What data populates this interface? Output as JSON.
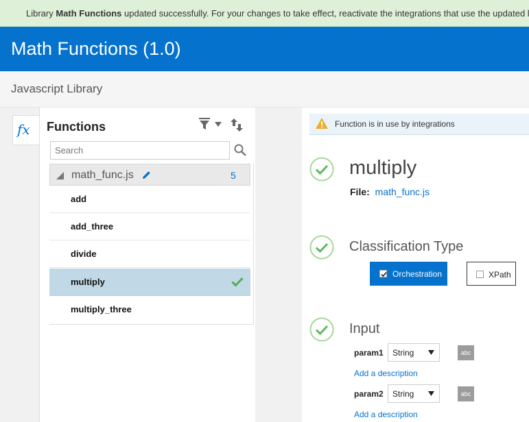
{
  "banner": {
    "prefix": "Library ",
    "library_name": "Math Functions",
    "suffix": " updated successfully. For your changes to take effect, reactivate the integrations that use the updated library."
  },
  "header": {
    "title": "Math Functions (1.0)"
  },
  "subheader": {
    "type_label": "Javascript Library"
  },
  "fx_tab": {
    "label": "fx"
  },
  "functions_panel": {
    "title": "Functions",
    "search_placeholder": "Search",
    "group": {
      "name": "math_func.js",
      "count": "5"
    },
    "items": [
      {
        "name": "add",
        "selected": false
      },
      {
        "name": "add_three",
        "selected": false
      },
      {
        "name": "divide",
        "selected": false
      },
      {
        "name": "multiply",
        "selected": true
      },
      {
        "name": "multiply_three",
        "selected": false
      }
    ]
  },
  "detail": {
    "warning": "Function is in use by integrations",
    "function_name": "multiply",
    "file_label": "File:",
    "file_value": "math_func.js",
    "classification": {
      "title": "Classification Type",
      "options": [
        {
          "label": "Orchestration",
          "checked": true
        },
        {
          "label": "XPath",
          "checked": false
        }
      ]
    },
    "input": {
      "title": "Input",
      "params": [
        {
          "name": "param1",
          "type": "String",
          "badge": "abc",
          "add_description": "Add a description"
        },
        {
          "name": "param2",
          "type": "String",
          "badge": "abc",
          "add_description": "Add a description"
        }
      ]
    }
  },
  "colors": {
    "brand_blue": "#0572ce",
    "success_bg": "#dff0d8",
    "success_green": "#5cb85c",
    "selected_row": "#c1d8e6",
    "warning_yellow": "#f0ad2c"
  }
}
